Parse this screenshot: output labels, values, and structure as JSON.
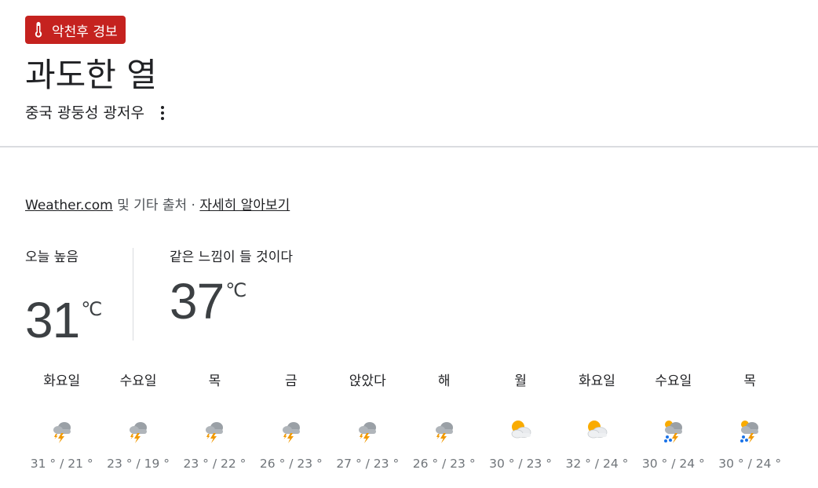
{
  "alert": {
    "label": "악천후 경보",
    "icon": "thermometer-icon",
    "color": "#c5221f"
  },
  "title": "과도한 열",
  "location": "중국 광둥성 광저우",
  "source": {
    "link": "Weather.com",
    "middle": " 및 기타 출처 · ",
    "learn_more": "자세히 알아보기"
  },
  "today_high": {
    "label": "오늘 높음",
    "value": "31",
    "unit": "℃"
  },
  "feels_like": {
    "label": "같은 느낌이 들 것이다",
    "value": "37",
    "unit": "℃"
  },
  "forecast": [
    {
      "day": "화요일",
      "icon": "thunderstorm-icon",
      "temps": "31 ° / 21 °"
    },
    {
      "day": "수요일",
      "icon": "thunderstorm-icon",
      "temps": "23 ° / 19 °"
    },
    {
      "day": "목",
      "icon": "thunderstorm-icon",
      "temps": "23 ° / 22 °"
    },
    {
      "day": "금",
      "icon": "thunderstorm-icon",
      "temps": "26 ° / 23 °"
    },
    {
      "day": "앉았다",
      "icon": "thunderstorm-icon",
      "temps": "27 ° / 23 °"
    },
    {
      "day": "해",
      "icon": "thunderstorm-icon",
      "temps": "26 ° / 23 °"
    },
    {
      "day": "월",
      "icon": "partly-cloudy-icon",
      "temps": "30 ° / 23 °"
    },
    {
      "day": "화요일",
      "icon": "partly-cloudy-icon",
      "temps": "32 ° / 24 °"
    },
    {
      "day": "수요일",
      "icon": "rain-thunder-icon",
      "temps": "30 ° / 24 °"
    },
    {
      "day": "목",
      "icon": "rain-thunder-icon",
      "temps": "30 ° / 24 °"
    }
  ]
}
